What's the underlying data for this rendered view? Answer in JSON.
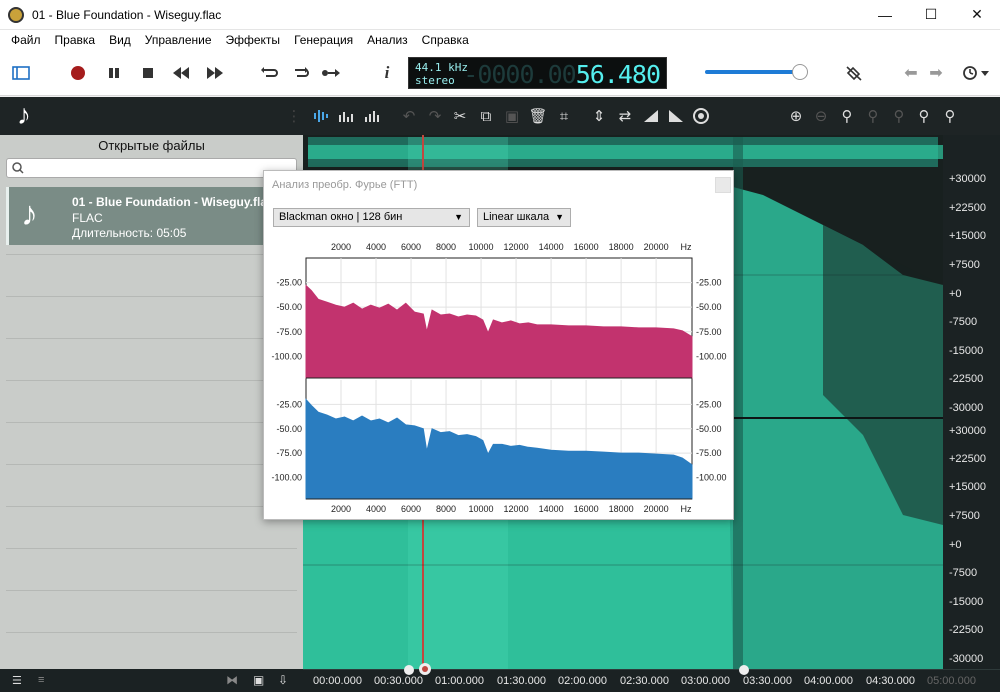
{
  "window": {
    "title": "01 - Blue Foundation - Wiseguy.flac",
    "min": "—",
    "max": "☐",
    "close": "✕"
  },
  "menu": [
    "Файл",
    "Правка",
    "Вид",
    "Управление",
    "Эффекты",
    "Генерация",
    "Анализ",
    "Справка"
  ],
  "lcd": {
    "rate": "44.1 kHz",
    "channels": "stereo",
    "ghost_digits": "-0000.00",
    "time": "56.480"
  },
  "volume_level": 0.95,
  "panel": {
    "header": "Открытые файлы",
    "search_placeholder": "",
    "file": {
      "name": "01 - Blue Foundation - Wiseguy.flac",
      "format": "FLAC",
      "duration": "Длительность: 05:05"
    }
  },
  "scale_labels": [
    "+30000",
    "+22500",
    "+15000",
    "+7500",
    "+0",
    "-7500",
    "-15000",
    "-22500",
    "-30000",
    "+30000",
    "+22500",
    "+15000",
    "+7500",
    "+0",
    "-7500",
    "-15000",
    "-22500",
    "-30000"
  ],
  "timeline_labels": [
    "00:00.000",
    "00:30.000",
    "01:00.000",
    "01:30.000",
    "02:00.000",
    "02:30.000",
    "03:00.000",
    "03:30.000",
    "04:00.000",
    "04:30.000",
    "05:00.000"
  ],
  "fft": {
    "title": "Анализ преобр. Фурье (FTT)",
    "window_select": "Blackman окно | 128 бин",
    "scale_select": "Linear шкала",
    "unit": "Hz"
  },
  "chart_data": [
    {
      "type": "area",
      "title": "",
      "x_ticks": [
        "2000",
        "4000",
        "6000",
        "8000",
        "10000",
        "12000",
        "14000",
        "16000",
        "18000",
        "20000"
      ],
      "xlabel": "Hz",
      "xlim": [
        0,
        22050
      ],
      "y_ticks": [
        "-25.00",
        "-50.00",
        "-75.00",
        "-100.00"
      ],
      "ylim": [
        -122,
        0
      ],
      "series": [
        {
          "color": "#c2336e",
          "x": [
            0,
            300,
            700,
            1200,
            1700,
            2200,
            2700,
            3200,
            3700,
            4200,
            4700,
            5200,
            5700,
            6200,
            6700,
            6900,
            7200,
            7700,
            8200,
            8700,
            9200,
            9700,
            10100,
            10400,
            10700,
            11200,
            11700,
            12200,
            12700,
            13200,
            14000,
            15000,
            16000,
            17000,
            18000,
            19000,
            20000,
            21000,
            21500,
            22050
          ],
          "values": [
            -28,
            -33,
            -42,
            -45,
            -48,
            -50,
            -46,
            -52,
            -48,
            -51,
            -47,
            -53,
            -46,
            -55,
            -57,
            -75,
            -53,
            -58,
            -57,
            -60,
            -58,
            -59,
            -63,
            -76,
            -63,
            -66,
            -64,
            -67,
            -66,
            -68,
            -68,
            -69,
            -69,
            -70,
            -70,
            -71,
            -71,
            -72,
            -74,
            -80
          ]
        },
        {
          "color": "#2a7dc0",
          "x": [
            0,
            300,
            700,
            1200,
            1700,
            2200,
            2700,
            3200,
            3700,
            4200,
            4700,
            5200,
            5700,
            6200,
            6700,
            6900,
            7200,
            7700,
            8200,
            8700,
            9200,
            9700,
            10100,
            10400,
            10700,
            11200,
            11700,
            12200,
            12700,
            13200,
            14000,
            15000,
            16000,
            17000,
            18000,
            19000,
            20000,
            21000,
            21500,
            22050
          ],
          "values": [
            -20,
            -26,
            -33,
            -36,
            -40,
            -38,
            -42,
            -37,
            -42,
            -40,
            -44,
            -39,
            -46,
            -47,
            -50,
            -73,
            -50,
            -54,
            -53,
            -57,
            -56,
            -58,
            -62,
            -76,
            -66,
            -66,
            -68,
            -67,
            -69,
            -70,
            -72,
            -73,
            -73,
            -74,
            -75,
            -75,
            -76,
            -77,
            -80,
            -87
          ]
        }
      ]
    }
  ]
}
